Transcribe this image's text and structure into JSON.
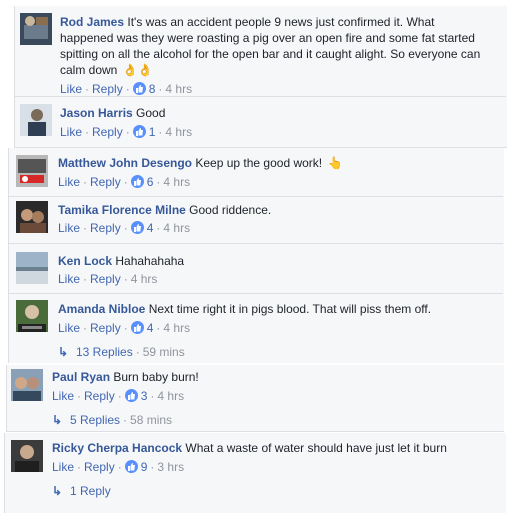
{
  "labels": {
    "like": "Like",
    "reply": "Reply"
  },
  "comments": [
    {
      "author": "Rod James",
      "text": "It's was an accident people 9 news just confirmed it. What happened was they were roasting a pig over an open fire and some fat started spitting on all the alcohol for the open bar and it caught alight. So everyone can calm down",
      "emoji": "👌👌",
      "likes": "8",
      "time": "4 hrs"
    },
    {
      "author": "Jason Harris",
      "text": "Good",
      "emoji": "",
      "likes": "1",
      "time": "4 hrs"
    },
    {
      "author": "Matthew John Desengo",
      "text": "Keep up the good work!",
      "emoji": "👆",
      "likes": "6",
      "time": "4 hrs"
    },
    {
      "author": "Tamika Florence Milne",
      "text": "Good riddence.",
      "emoji": "",
      "likes": "4",
      "time": "4 hrs"
    },
    {
      "author": "Ken Lock",
      "text": "Hahahahaha",
      "emoji": "",
      "likes": "",
      "time": "4 hrs"
    },
    {
      "author": "Amanda Nibloe",
      "text": "Next time right it in pigs blood. That will piss them off.",
      "emoji": "",
      "likes": "4",
      "time": "4 hrs",
      "replies": "13 Replies",
      "replies_time": "59 mins"
    },
    {
      "author": "Paul Ryan",
      "text": "Burn baby burn!",
      "emoji": "",
      "likes": "3",
      "time": "4 hrs",
      "replies": "5 Replies",
      "replies_time": "58 mins"
    },
    {
      "author": "Ricky Cherpa Hancock",
      "text": "What a waste of water should have just let it burn",
      "emoji": "",
      "likes": "9",
      "time": "3 hrs",
      "replies": "1 Reply",
      "replies_time": ""
    }
  ]
}
